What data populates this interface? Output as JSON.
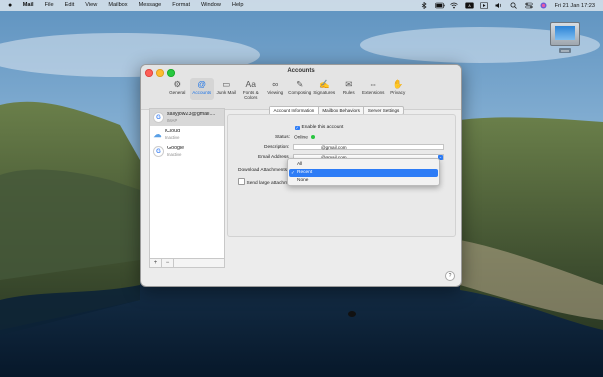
{
  "menubar": {
    "apple_icon": "apple-icon",
    "items": [
      "Mail",
      "File",
      "Edit",
      "View",
      "Mailbox",
      "Message",
      "Format",
      "Window",
      "Help"
    ],
    "status_icons": [
      "bluetooth-icon",
      "battery-icon",
      "wifi-icon",
      "keyboard-input-icon",
      "play-icon",
      "volume-icon",
      "search-icon",
      "control-center-icon",
      "siri-icon"
    ],
    "clock": "Fri 21 Jan  17:23"
  },
  "desktop": {
    "drive_label": "xxxx"
  },
  "window": {
    "title": "Accounts",
    "toolbar": [
      {
        "label": "General",
        "icon": "gear-icon"
      },
      {
        "label": "Accounts",
        "icon": "at-sign-icon",
        "active": true
      },
      {
        "label": "Junk Mail",
        "icon": "junk-tray-icon"
      },
      {
        "label": "Fonts & Colors",
        "icon": "fonts-icon"
      },
      {
        "label": "Viewing",
        "icon": "glasses-icon"
      },
      {
        "label": "Composing",
        "icon": "compose-icon"
      },
      {
        "label": "Signatures",
        "icon": "signature-icon"
      },
      {
        "label": "Rules",
        "icon": "rules-icon"
      },
      {
        "label": "Extensions",
        "icon": "extensions-icon"
      },
      {
        "label": "Privacy",
        "icon": "hand-icon"
      }
    ],
    "accounts": [
      {
        "name": "sallyjow23@gmail....",
        "type": "IMAP",
        "icon": "google-icon",
        "selected": true
      },
      {
        "name": "iCloud",
        "type": "Inactive",
        "icon": "icloud-icon"
      },
      {
        "name": "Google",
        "type": "Inactive",
        "icon": "google-icon"
      }
    ],
    "sidebar_footer": {
      "add": "+",
      "remove": "−"
    },
    "tabs": [
      "Account Information",
      "Mailbox Behaviors",
      "Server Settings"
    ],
    "form": {
      "enable_label": "Enable this account",
      "enable_checked": true,
      "status_label": "Status:",
      "status_value": "Online",
      "status_color": "#29c53f",
      "description_label": "Description:",
      "description_value": "@gmail.com",
      "email_label": "Email Address",
      "email_value": "@gmail.com",
      "download_label": "Download Attachments",
      "send_large_label": "Send large attachments"
    },
    "dropdown": {
      "options": [
        "All",
        "Recent",
        "None"
      ],
      "selected": "Recent"
    },
    "help": "?"
  },
  "colors": {
    "accent": "#2d7cf6",
    "close": "#fe5f57",
    "minimize": "#febc2e",
    "maximize": "#28c840"
  }
}
